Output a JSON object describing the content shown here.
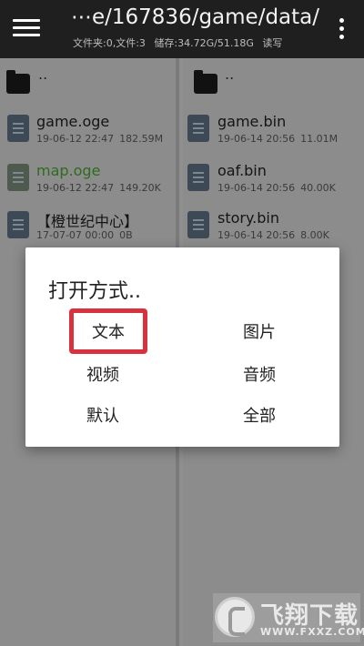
{
  "header": {
    "path": "⋯e/167836/game/data/",
    "folders": "文件夹:0,文件:3",
    "storage": "储存:34.72G/51.18G",
    "mode": "读写"
  },
  "left_pane": {
    "parent": "..",
    "files": [
      {
        "name": "game.oge",
        "date": "19-06-12 22:47",
        "size": "182.59M"
      },
      {
        "name": "map.oge",
        "date": "19-06-12 22:47",
        "size": "149.20K"
      },
      {
        "name": "【橙世纪中心】",
        "date": "17-07-07 00:00",
        "size": "0B"
      }
    ]
  },
  "right_pane": {
    "parent": "..",
    "files": [
      {
        "name": "game.bin",
        "date": "19-06-14 20:56",
        "size": "11.01M"
      },
      {
        "name": "oaf.bin",
        "date": "19-06-14 20:56",
        "size": "40.00K"
      },
      {
        "name": "story.bin",
        "date": "19-06-14 20:56",
        "size": "8.00K"
      }
    ]
  },
  "dialog": {
    "title": "打开方式..",
    "options": {
      "text": "文本",
      "image": "图片",
      "video": "视频",
      "audio": "音频",
      "default": "默认",
      "all": "全部"
    }
  },
  "watermark": {
    "text": "飞翔下载",
    "url": "WWW.FXXZ.COM"
  }
}
